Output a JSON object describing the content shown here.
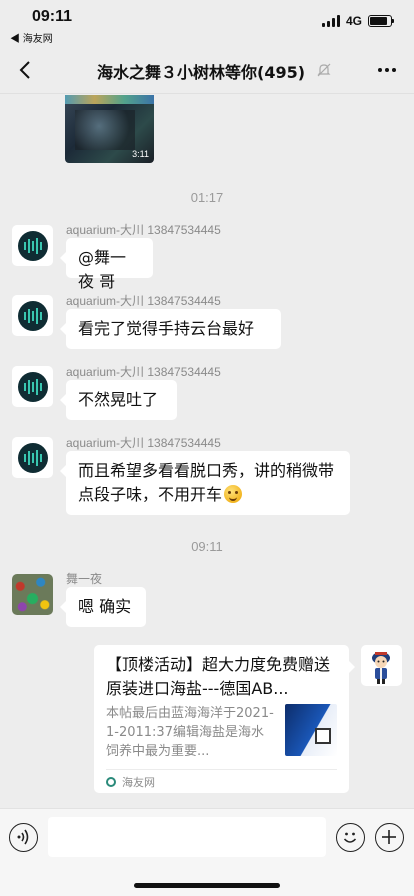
{
  "status_bar": {
    "time": "09:11",
    "back_label": "◀ 海友网",
    "network": "4G"
  },
  "header": {
    "title": "海水之舞３小树林等你(495)"
  },
  "messages": {
    "video_duration": "3:11",
    "time_1": "01:17",
    "time_2": "09:11",
    "m1": {
      "sender": "aquarium-大川 13847534445",
      "text": "@舞一夜 哥"
    },
    "m2": {
      "sender": "aquarium-大川 13847534445",
      "text": "看完了觉得手持云台最好"
    },
    "m3": {
      "sender": "aquarium-大川 13847534445",
      "text": "不然晃吐了"
    },
    "m4": {
      "sender": "aquarium-大川 13847534445",
      "text": "而且希望多看看脱口秀，讲的稍微带点段子味，不用开车"
    },
    "m5": {
      "sender": "舞一夜",
      "text": "嗯 确实"
    }
  },
  "link_card": {
    "title": "【顶楼活动】超大力度免费赠送原装进口海盐---德国AB...",
    "description": "本帖最后由蓝海海洋于2021-1-2011:37编辑海盐是海水饲养中最为重要...",
    "source": "海友网"
  }
}
